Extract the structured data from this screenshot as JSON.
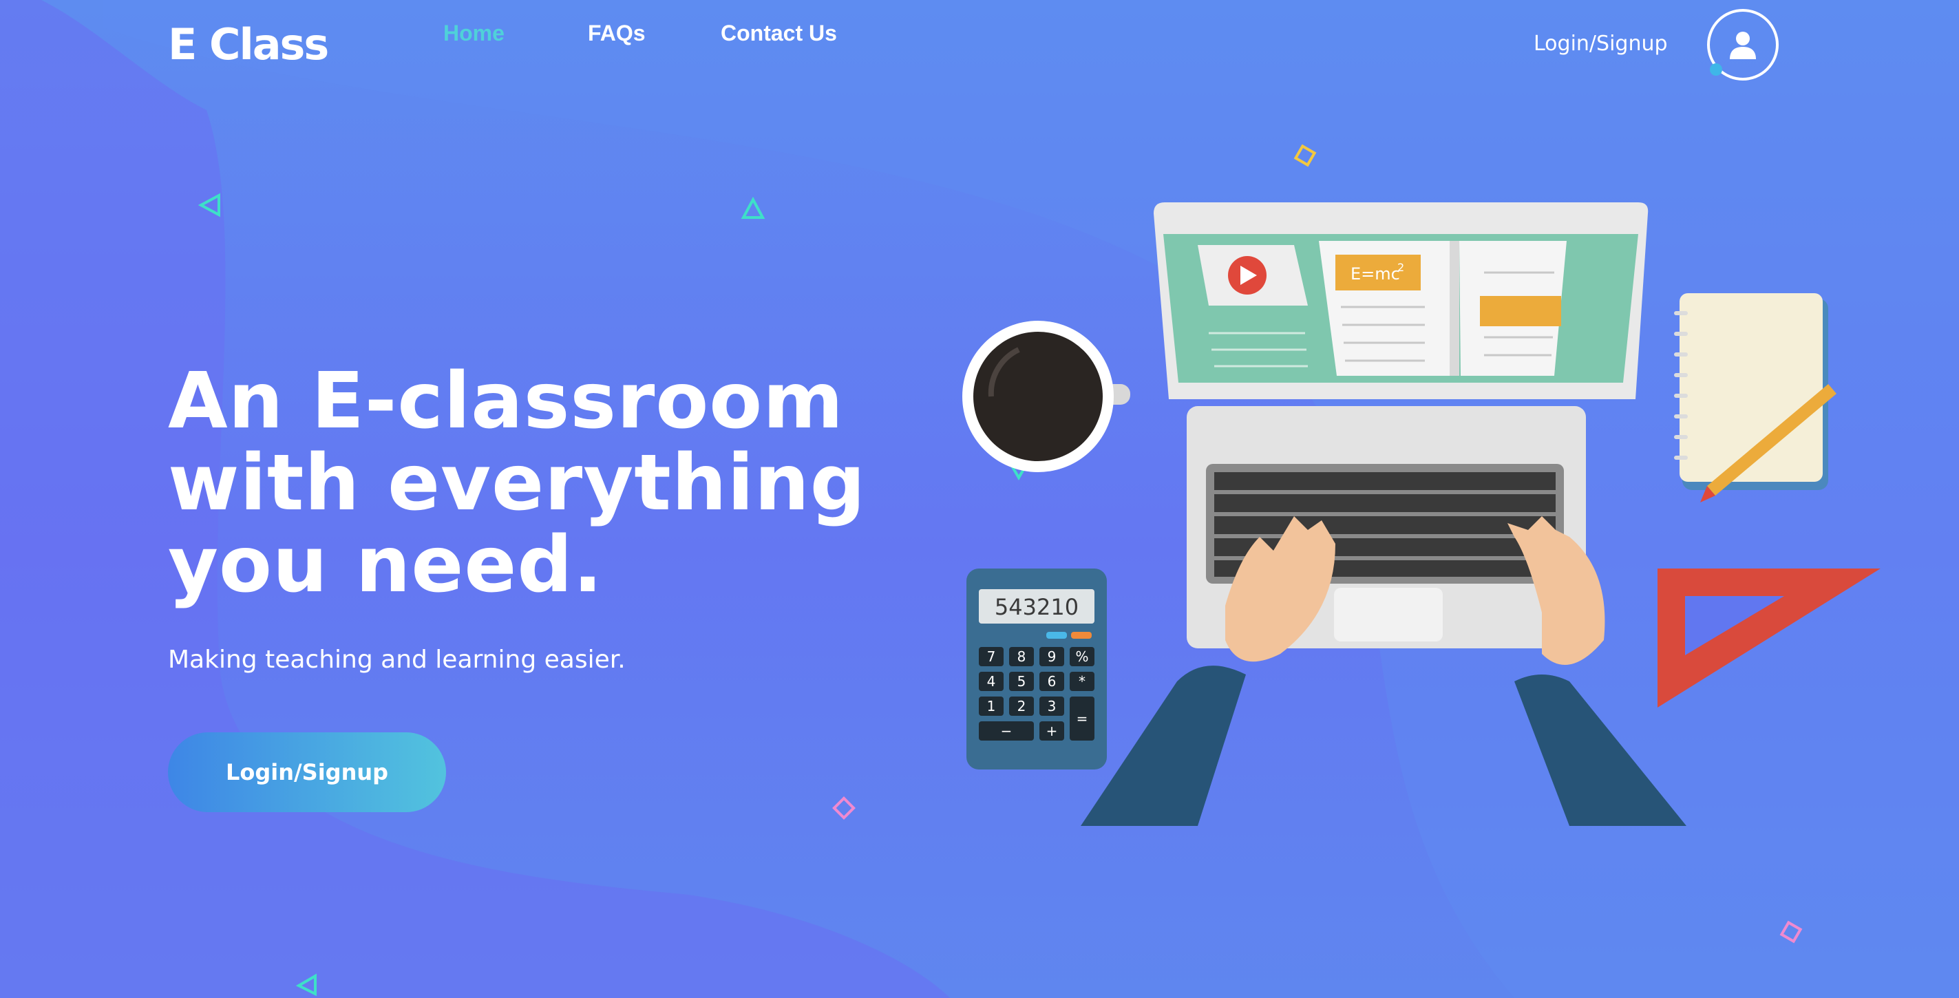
{
  "brand": {
    "logo_text": "E Class"
  },
  "nav": {
    "items": [
      {
        "label": "Home",
        "active": true
      },
      {
        "label": "FAQs",
        "active": false
      },
      {
        "label": "Contact Us",
        "active": false
      }
    ],
    "login_label": "Login/Signup",
    "avatar_icon": "user-icon"
  },
  "hero": {
    "title_lines": [
      "An E-classroom",
      "with everything",
      "you need."
    ],
    "subtitle": "Making teaching and learning easier.",
    "cta_label": "Login/Signup"
  },
  "illustration": {
    "calculator_display": "543210",
    "calculator_keys": [
      "7",
      "8",
      "9",
      "%",
      "4",
      "5",
      "6",
      "*",
      "1",
      "2",
      "3",
      "−",
      "+",
      "="
    ],
    "formula_base": "E=mc",
    "formula_exp": "2"
  },
  "colors": {
    "accent_teal": "#4fd1d9",
    "background_blue": "#6279f0",
    "cta_start": "#3e86e6",
    "cta_end": "#52c3de"
  }
}
